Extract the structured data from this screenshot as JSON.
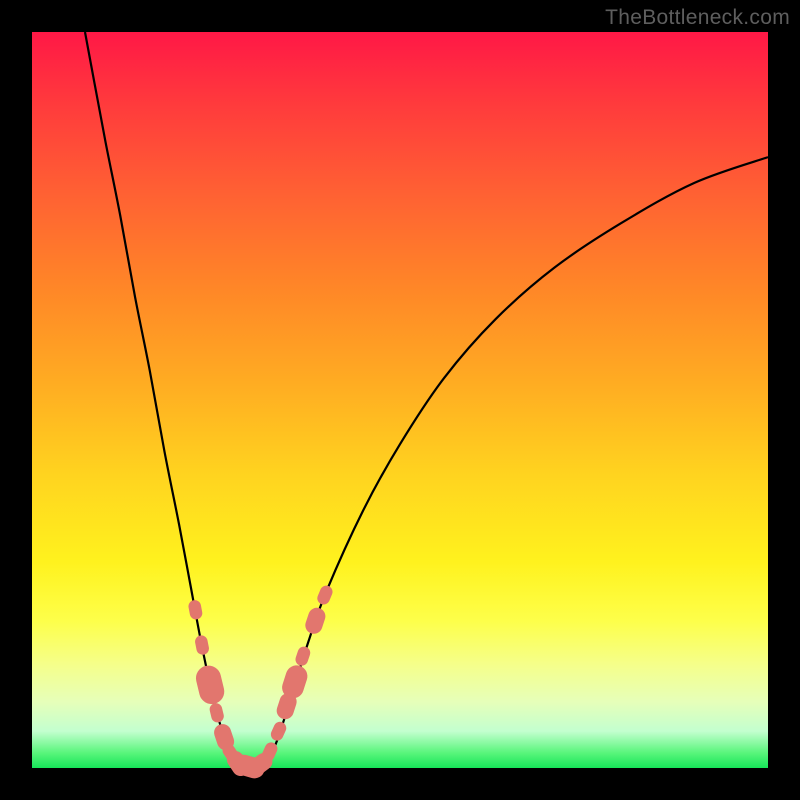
{
  "watermark": "TheBottleneck.com",
  "colors": {
    "frame": "#000000",
    "curve_stroke": "#000000",
    "marker_fill": "#e2766e",
    "marker_stroke": "#c9564f"
  },
  "chart_data": {
    "type": "line",
    "title": "",
    "xlabel": "",
    "ylabel": "",
    "xlim": [
      0,
      100
    ],
    "ylim": [
      0,
      100
    ],
    "curve": [
      {
        "x": 7.2,
        "y": 100.0
      },
      {
        "x": 8.5,
        "y": 93.0
      },
      {
        "x": 10.0,
        "y": 85.0
      },
      {
        "x": 12.0,
        "y": 75.0
      },
      {
        "x": 14.0,
        "y": 64.0
      },
      {
        "x": 16.0,
        "y": 54.0
      },
      {
        "x": 18.0,
        "y": 43.0
      },
      {
        "x": 20.0,
        "y": 33.0
      },
      {
        "x": 21.5,
        "y": 25.0
      },
      {
        "x": 23.0,
        "y": 17.0
      },
      {
        "x": 24.5,
        "y": 10.0
      },
      {
        "x": 26.0,
        "y": 4.5
      },
      {
        "x": 27.5,
        "y": 1.0
      },
      {
        "x": 29.0,
        "y": 0.0
      },
      {
        "x": 31.0,
        "y": 0.0
      },
      {
        "x": 33.0,
        "y": 3.0
      },
      {
        "x": 35.0,
        "y": 9.0
      },
      {
        "x": 37.5,
        "y": 17.0
      },
      {
        "x": 40.0,
        "y": 24.0
      },
      {
        "x": 45.0,
        "y": 35.0
      },
      {
        "x": 50.0,
        "y": 44.0
      },
      {
        "x": 56.0,
        "y": 53.0
      },
      {
        "x": 63.0,
        "y": 61.0
      },
      {
        "x": 71.0,
        "y": 68.0
      },
      {
        "x": 80.0,
        "y": 74.0
      },
      {
        "x": 90.0,
        "y": 79.5
      },
      {
        "x": 100.0,
        "y": 83.0
      }
    ],
    "markers": [
      {
        "x": 22.2,
        "y": 21.5,
        "r": 1.1
      },
      {
        "x": 23.1,
        "y": 16.7,
        "r": 1.1
      },
      {
        "x": 24.2,
        "y": 11.3,
        "r": 2.2
      },
      {
        "x": 25.1,
        "y": 7.5,
        "r": 1.1
      },
      {
        "x": 26.1,
        "y": 4.2,
        "r": 1.5
      },
      {
        "x": 27.0,
        "y": 2.0,
        "r": 1.1
      },
      {
        "x": 28.0,
        "y": 0.6,
        "r": 1.5
      },
      {
        "x": 29.5,
        "y": 0.2,
        "r": 1.8
      },
      {
        "x": 31.0,
        "y": 0.5,
        "r": 1.5
      },
      {
        "x": 32.3,
        "y": 2.2,
        "r": 1.1
      },
      {
        "x": 33.5,
        "y": 5.0,
        "r": 1.1
      },
      {
        "x": 34.6,
        "y": 8.4,
        "r": 1.5
      },
      {
        "x": 35.7,
        "y": 11.7,
        "r": 1.9
      },
      {
        "x": 36.8,
        "y": 15.2,
        "r": 1.1
      },
      {
        "x": 38.5,
        "y": 20.0,
        "r": 1.5
      },
      {
        "x": 39.8,
        "y": 23.5,
        "r": 1.1
      }
    ]
  }
}
